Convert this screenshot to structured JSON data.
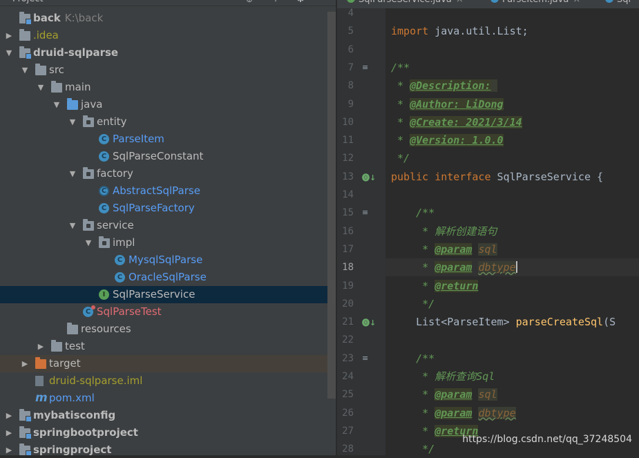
{
  "project_panel": {
    "header_title": "Project",
    "tree": [
      {
        "label": "back",
        "path": "K:\\back",
        "bold": true,
        "indent": 0,
        "arrow": "",
        "icon": "module-folder-icon"
      },
      {
        "label": ".idea",
        "indent": 0,
        "arrow": "▶",
        "icon": "folder-icon",
        "color": "olive"
      },
      {
        "label": "druid-sqlparse",
        "bold": true,
        "indent": 0,
        "arrow": "▼",
        "icon": "module-folder-icon"
      },
      {
        "label": "src",
        "indent": 1,
        "arrow": "▼",
        "icon": "folder-icon"
      },
      {
        "label": "main",
        "indent": 2,
        "arrow": "▼",
        "icon": "folder-icon"
      },
      {
        "label": "java",
        "indent": 3,
        "arrow": "▼",
        "icon": "source-folder-icon"
      },
      {
        "label": "entity",
        "indent": 4,
        "arrow": "▼",
        "icon": "package-icon"
      },
      {
        "label": "ParseItem",
        "indent": 5,
        "arrow": "",
        "icon": "class-icon",
        "color": "blue"
      },
      {
        "label": "SqlParseConstant",
        "indent": 5,
        "arrow": "",
        "icon": "class-icon"
      },
      {
        "label": "factory",
        "indent": 4,
        "arrow": "▼",
        "icon": "package-icon"
      },
      {
        "label": "AbstractSqlParse",
        "indent": 5,
        "arrow": "",
        "icon": "abstract-class-icon",
        "color": "blue"
      },
      {
        "label": "SqlParseFactory",
        "indent": 5,
        "arrow": "",
        "icon": "class-icon",
        "color": "blue"
      },
      {
        "label": "service",
        "indent": 4,
        "arrow": "▼",
        "icon": "package-icon"
      },
      {
        "label": "impl",
        "indent": 5,
        "arrow": "▼",
        "icon": "package-icon"
      },
      {
        "label": "MysqlSqlParse",
        "indent": 6,
        "arrow": "",
        "icon": "class-icon",
        "color": "blue"
      },
      {
        "label": "OracleSqlParse",
        "indent": 6,
        "arrow": "",
        "icon": "class-icon",
        "color": "blue"
      },
      {
        "label": "SqlParseService",
        "indent": 5,
        "arrow": "",
        "icon": "interface-icon",
        "selected": true
      },
      {
        "label": "SqlParseTest",
        "indent": 4,
        "arrow": "",
        "icon": "test-class-icon",
        "color": "red"
      },
      {
        "label": "resources",
        "indent": 3,
        "arrow": "",
        "icon": "resources-folder-icon"
      },
      {
        "label": "test",
        "indent": 2,
        "arrow": "▶",
        "icon": "folder-icon"
      },
      {
        "label": "target",
        "indent": 1,
        "arrow": "▶",
        "icon": "excluded-folder-icon",
        "highlight": true
      },
      {
        "label": "druid-sqlparse.iml",
        "indent": 1,
        "arrow": "",
        "icon": "iml-file-icon",
        "color": "olive"
      },
      {
        "label": "pom.xml",
        "indent": 1,
        "arrow": "",
        "icon": "maven-icon",
        "color": "blue"
      },
      {
        "label": "mybatisconfig",
        "bold": true,
        "indent": 0,
        "arrow": "▶",
        "icon": "module-folder-icon"
      },
      {
        "label": "springbootproject",
        "bold": true,
        "indent": 0,
        "arrow": "▶",
        "icon": "module-folder-icon"
      },
      {
        "label": "springproject",
        "bold": true,
        "indent": 0,
        "arrow": "▶",
        "icon": "module-folder-icon"
      }
    ]
  },
  "editor_tabs": [
    {
      "label": "SqlParseService.java",
      "active": true,
      "icon": "interface-icon"
    },
    {
      "label": "ParseItem.java",
      "active": false,
      "icon": "class-icon"
    },
    {
      "label": "Sql",
      "active": false,
      "icon": "class-icon"
    }
  ],
  "editor": {
    "current_line": 18,
    "lines": [
      {
        "n": 4,
        "html": ""
      },
      {
        "n": 5,
        "html": "<span class='kw'>import</span> java.util.List;"
      },
      {
        "n": 6,
        "html": ""
      },
      {
        "n": 7,
        "html": "<span class='doc'>/**</span>"
      },
      {
        "n": 8,
        "html": "<span class='doc'> * </span><span class='tag'>@Description:</span><span class='tagv'> </span>"
      },
      {
        "n": 9,
        "html": "<span class='doc'> * </span><span class='tag'>@Author:</span><span class='tag'> LiDong</span>"
      },
      {
        "n": 10,
        "html": "<span class='doc'> * </span><span class='tag'>@Create:</span><span class='tag'> 2021/3/14</span>"
      },
      {
        "n": 11,
        "html": "<span class='doc'> * </span><span class='tag'>@Version:</span><span class='tag'> 1.0.0</span>"
      },
      {
        "n": 12,
        "html": "<span class='doc'> */</span>"
      },
      {
        "n": 13,
        "html": "<span class='kw'>public interface</span> SqlParseService {"
      },
      {
        "n": 14,
        "html": ""
      },
      {
        "n": 15,
        "html": "    <span class='doc'>/**</span>"
      },
      {
        "n": 16,
        "html": "<span class='doc'>     * 解析创建语句</span>"
      },
      {
        "n": 17,
        "html": "<span class='doc'>     * </span><span class='tag'>@param</span> <span class='tagv'>sql</span>"
      },
      {
        "n": 18,
        "html": "<span class='doc'>     * </span><span class='tag'>@param</span> <span class='tagv squiggle'>dbtype</span><span class='caret'></span>"
      },
      {
        "n": 19,
        "html": "<span class='doc'>     * </span><span class='tag'>@return</span>"
      },
      {
        "n": 20,
        "html": "<span class='doc'>     */</span>"
      },
      {
        "n": 21,
        "html": "    List&lt;ParseItem&gt; <span class='method'>parseCreateSql</span>(S"
      },
      {
        "n": 22,
        "html": ""
      },
      {
        "n": 23,
        "html": "    <span class='doc'>/**</span>"
      },
      {
        "n": 24,
        "html": "<span class='doc'>     * 解析查询Sql</span>"
      },
      {
        "n": 25,
        "html": "<span class='doc'>     * </span><span class='tag'>@param</span> <span class='tagv'>sql</span>"
      },
      {
        "n": 26,
        "html": "<span class='doc'>     * </span><span class='tag'>@param</span> <span class='tagv squiggle'>dbtype</span>"
      },
      {
        "n": 27,
        "html": "<span class='doc'>     * </span><span class='tag'>@return</span>"
      },
      {
        "n": 28,
        "html": "<span class='doc'>     */</span>"
      }
    ],
    "gutter_marks": [
      {
        "line": 7,
        "type": "doc-render-icon"
      },
      {
        "line": 13,
        "type": "implemented-icon"
      },
      {
        "line": 15,
        "type": "doc-render-icon"
      },
      {
        "line": 21,
        "type": "implemented-icon"
      },
      {
        "line": 23,
        "type": "doc-render-icon"
      }
    ]
  },
  "watermark": "https://blog.csdn.net/qq_37248504"
}
